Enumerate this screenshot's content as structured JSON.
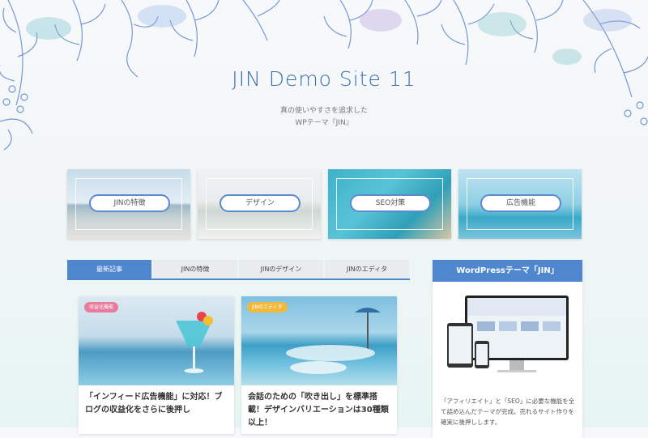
{
  "site": {
    "title": "JIN Demo Site 11",
    "tagline_line1": "真の使いやすさを追求した",
    "tagline_line2": "WPテーマ『JIN』"
  },
  "pickup": [
    {
      "label": "JINの特徴"
    },
    {
      "label": "デザイン"
    },
    {
      "label": "SEO対策"
    },
    {
      "label": "広告機能"
    }
  ],
  "tabs": [
    {
      "label": "最新記事",
      "active": true
    },
    {
      "label": "JINの特徴",
      "active": false
    },
    {
      "label": "JINのデザイン",
      "active": false
    },
    {
      "label": "JINのエディタ",
      "active": false
    }
  ],
  "posts": [
    {
      "category": "収益化機能",
      "title": "「インフィード広告機能」に対応！ブログの収益化をさらに後押し"
    },
    {
      "category": "JINのエディタ",
      "title": "会話のための「吹き出し」を標準搭載！デザインバリエーションは30種類以上！"
    }
  ],
  "sidebar": {
    "heading": "WordPressテーマ「JIN」",
    "description": "「アフィリエイト」と「SEO」に必要な機能を全て詰め込んだテーマが完成。売れるサイト作りを確実に後押しします。"
  },
  "colors": {
    "accent": "#4f87cf",
    "title": "#3b6fb0",
    "tag_pink": "#e97b9b",
    "tag_yellow": "#f0b93c"
  }
}
